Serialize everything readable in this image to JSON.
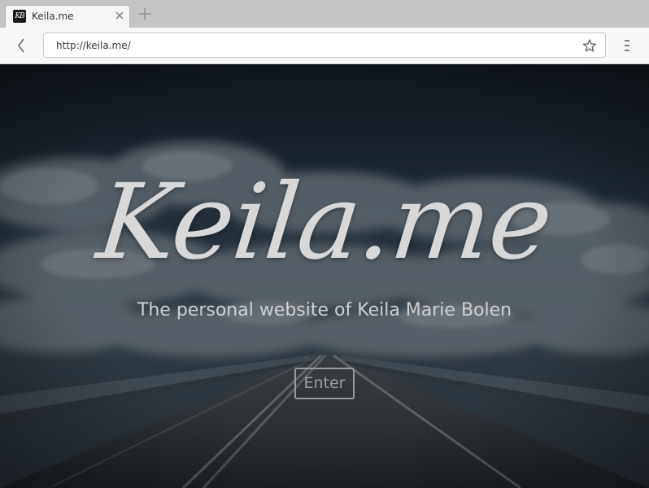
{
  "browser": {
    "tab": {
      "title": "Keila.me",
      "favicon_text": "KB"
    },
    "url": "http://keila.me/"
  },
  "hero": {
    "brand": "Keila.me",
    "tagline": "The personal website of Keila Marie Bolen",
    "enter_label": "Enter"
  },
  "icons": {
    "close": "close-icon",
    "new_tab": "plus-icon",
    "back": "chevron-left-icon",
    "bookmark": "star-icon",
    "menu": "menu-icon"
  },
  "colors": {
    "brand_text": "#d8d8d8",
    "tagline_text": "#d0d0d0",
    "enter_border": "#9a9a9a"
  }
}
